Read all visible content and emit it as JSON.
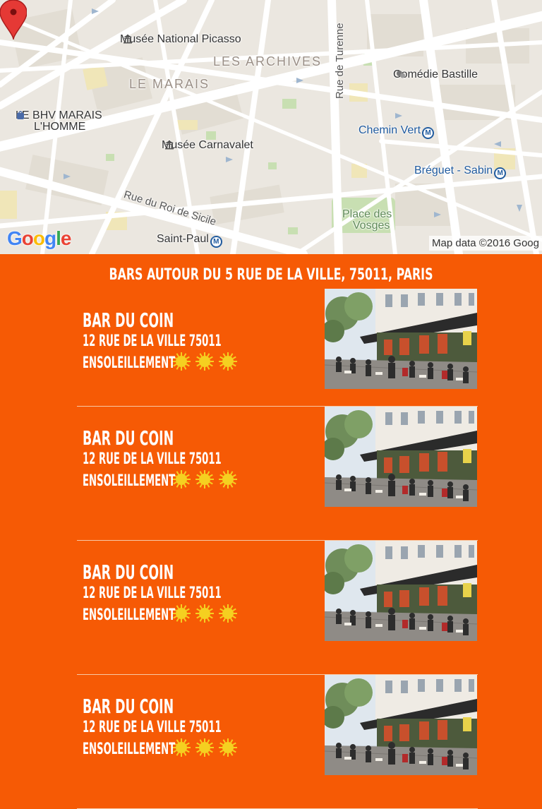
{
  "map": {
    "labels": {
      "picasso": "Musée National Picasso",
      "archives": "LES ARCHIVES",
      "marais": "LE MARAIS",
      "bhv_line1": "LE BHV MARAIS",
      "bhv_line2": "L'HOMME",
      "carnavalet": "Musée Carnavalet",
      "comedie": "Comédie Bastille",
      "chemin_vert": "Chemin Vert",
      "breguet": "Bréguet - Sabin",
      "roi_sicile": "Rue du Roi de Sicile",
      "turenne": "Rue de Turenne",
      "place_line1": "Place des",
      "place_line2": "Vosges",
      "saint_paul": "Saint-Paul"
    },
    "logo": "Google",
    "attribution": "Map data ©2016 Goog",
    "metro_glyph": "M"
  },
  "list": {
    "title": "Bars autour du 5 rue de la ville, 75011, Paris",
    "sunshine_level": 3,
    "sunshine_max": 3,
    "items": [
      {
        "name": "Bar du coin",
        "address": "12 rue de la ville 75011",
        "sun_label": "Ensoleillement"
      },
      {
        "name": "Bar du coin",
        "address": "12 rue de la ville 75011",
        "sun_label": "Ensoleillement"
      },
      {
        "name": "Bar du coin",
        "address": "12 rue de la ville 75011",
        "sun_label": "Ensoleillement"
      },
      {
        "name": "Bar du coin",
        "address": "12 rue de la ville 75011",
        "sun_label": "Ensoleillement"
      }
    ]
  },
  "colors": {
    "background": "#f65a05",
    "text": "#ffffff",
    "divider": "#f7c8a5",
    "sun": "#f5d020",
    "pin": "#e53935"
  },
  "icons": [
    "map-pin-icon",
    "museum-icon",
    "metro-icon",
    "theater-icon",
    "shopping-icon",
    "sun-icon"
  ]
}
